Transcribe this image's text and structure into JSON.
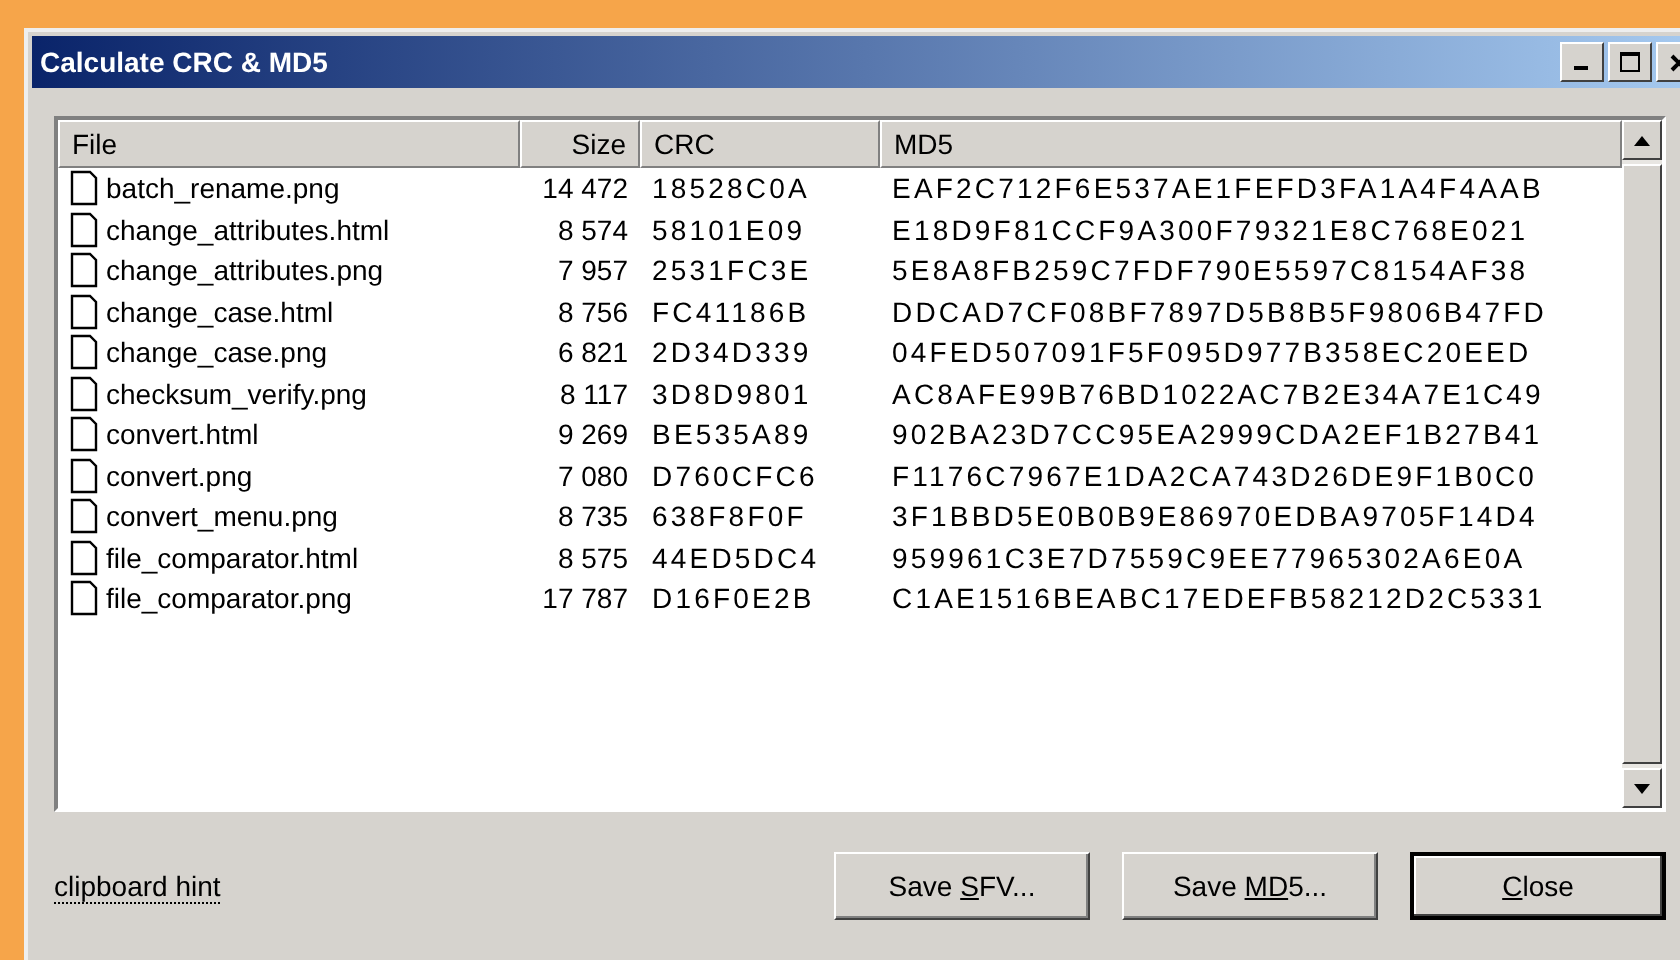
{
  "window": {
    "title": "Calculate CRC & MD5"
  },
  "table": {
    "columns": [
      "File",
      "Size",
      "CRC",
      "MD5"
    ],
    "rows": [
      {
        "file": "batch_rename.png",
        "size": "14 472",
        "crc": "18528C0A",
        "md5": "EAF2C712F6E537AE1FEFD3FA1A4F4AAB"
      },
      {
        "file": "change_attributes.html",
        "size": "8 574",
        "crc": "58101E09",
        "md5": "E18D9F81CCF9A300F79321E8C768E021"
      },
      {
        "file": "change_attributes.png",
        "size": "7 957",
        "crc": "2531FC3E",
        "md5": "5E8A8FB259C7FDF790E5597C8154AF38"
      },
      {
        "file": "change_case.html",
        "size": "8 756",
        "crc": "FC41186B",
        "md5": "DDCAD7CF08BF7897D5B8B5F9806B47FD"
      },
      {
        "file": "change_case.png",
        "size": "6 821",
        "crc": "2D34D339",
        "md5": "04FED507091F5F095D977B358EC20EED"
      },
      {
        "file": "checksum_verify.png",
        "size": "8 117",
        "crc": "3D8D9801",
        "md5": "AC8AFE99B76BD1022AC7B2E34A7E1C49"
      },
      {
        "file": "convert.html",
        "size": "9 269",
        "crc": "BE535A89",
        "md5": "902BA23D7CC95EA2999CDA2EF1B27B41"
      },
      {
        "file": "convert.png",
        "size": "7 080",
        "crc": "D760CFC6",
        "md5": "F1176C7967E1DA2CA743D26DE9F1B0C0"
      },
      {
        "file": "convert_menu.png",
        "size": "8 735",
        "crc": "638F8F0F",
        "md5": "3F1BBD5E0B0B9E86970EDBA9705F14D4"
      },
      {
        "file": "file_comparator.html",
        "size": "8 575",
        "crc": "44ED5DC4",
        "md5": "959961C3E7D7559C9EE77965302A6E0A"
      },
      {
        "file": "file_comparator.png",
        "size": "17 787",
        "crc": "D16F0E2B",
        "md5": "C1AE1516BEABC17EDEFB58212D2C5331"
      }
    ]
  },
  "hint": "clipboard hint",
  "buttons": [
    {
      "before": "Save ",
      "key": "S",
      "after": "FV...",
      "default": false
    },
    {
      "before": "Save ",
      "key": "MD",
      "after": "5...",
      "default": false
    },
    {
      "key": "C",
      "after": "lose",
      "default": true
    }
  ]
}
